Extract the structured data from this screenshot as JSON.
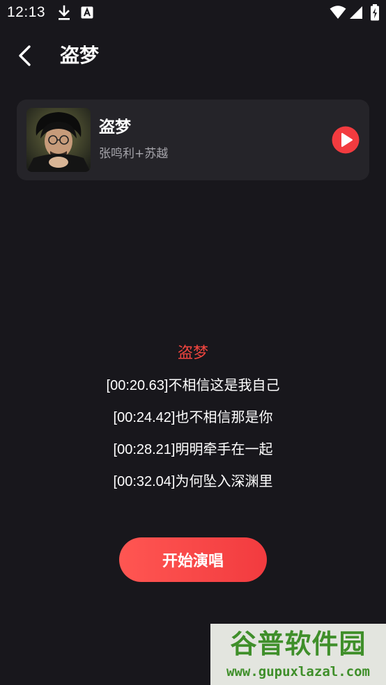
{
  "status_bar": {
    "time": "12:13",
    "icons": [
      "download-icon",
      "font-a-icon",
      "wifi-icon",
      "signal-icon",
      "battery-charging-icon"
    ]
  },
  "header": {
    "back_icon": "chevron-left-icon",
    "title": "盗梦"
  },
  "song_card": {
    "title": "盗梦",
    "artist": "张鸣利+苏越",
    "play_icon": "play-icon"
  },
  "lyrics": {
    "title": "盗梦",
    "lines": [
      "[00:20.63]不相信这是我自己",
      "[00:24.42]也不相信那是你",
      "[00:28.21]明明牵手在一起",
      "[00:32.04]为何坠入深渊里"
    ]
  },
  "actions": {
    "start_label": "开始演唱"
  },
  "watermark": {
    "brand": "谷普软件园",
    "url": "www.gupuxlazal.com"
  },
  "colors": {
    "background": "#18171c",
    "card": "#252429",
    "accent": "#f0453f",
    "watermark_green": "#3f8f2a"
  }
}
